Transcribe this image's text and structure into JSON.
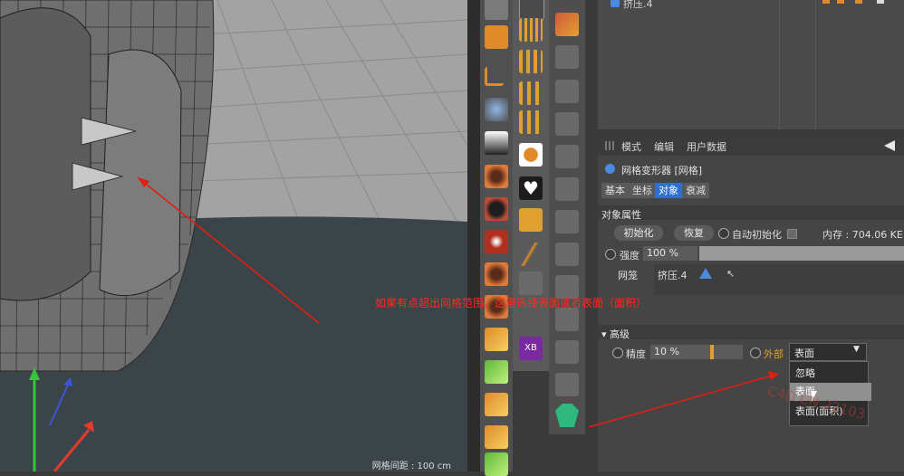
{
  "viewport": {
    "status_text": "网格间距 : 100 cm"
  },
  "object_manager": {
    "item_label": "挤压.4"
  },
  "attributes": {
    "menu": [
      "模式",
      "编辑",
      "用户数据"
    ],
    "object_header": "网格变形器 [网格]",
    "tabs": [
      "基本",
      "坐标",
      "对象",
      "衰减"
    ],
    "active_tab": "对象",
    "section_object": "对象属性",
    "init_button": "初始化",
    "restore_button": "恢复",
    "auto_init_label": "自动初始化",
    "memory_label": "内存 : 704.06 KE",
    "strength_label": "强度",
    "strength_value": "100 %",
    "strength_fraction": 1.0,
    "mesh_label": "网笼",
    "mesh_value": "挤压.4",
    "section_advanced": "高级",
    "precision_label": "精度",
    "precision_value": "10 %",
    "outer_label": "外部",
    "outer_value": "表面",
    "outer_options": [
      "忽略",
      "表面",
      "表面(面积)"
    ],
    "hover_option_index": 1
  },
  "annotation": {
    "text": "如果有点超出网格范围，这里选择表面或者表面（面积）",
    "color": "#ff2a1a"
  },
  "colors": {
    "active_tab": "#2f6fd0",
    "annotation_arrow": "#e02010"
  },
  "watermark": {
    "text": "C4D.CN 22103"
  }
}
